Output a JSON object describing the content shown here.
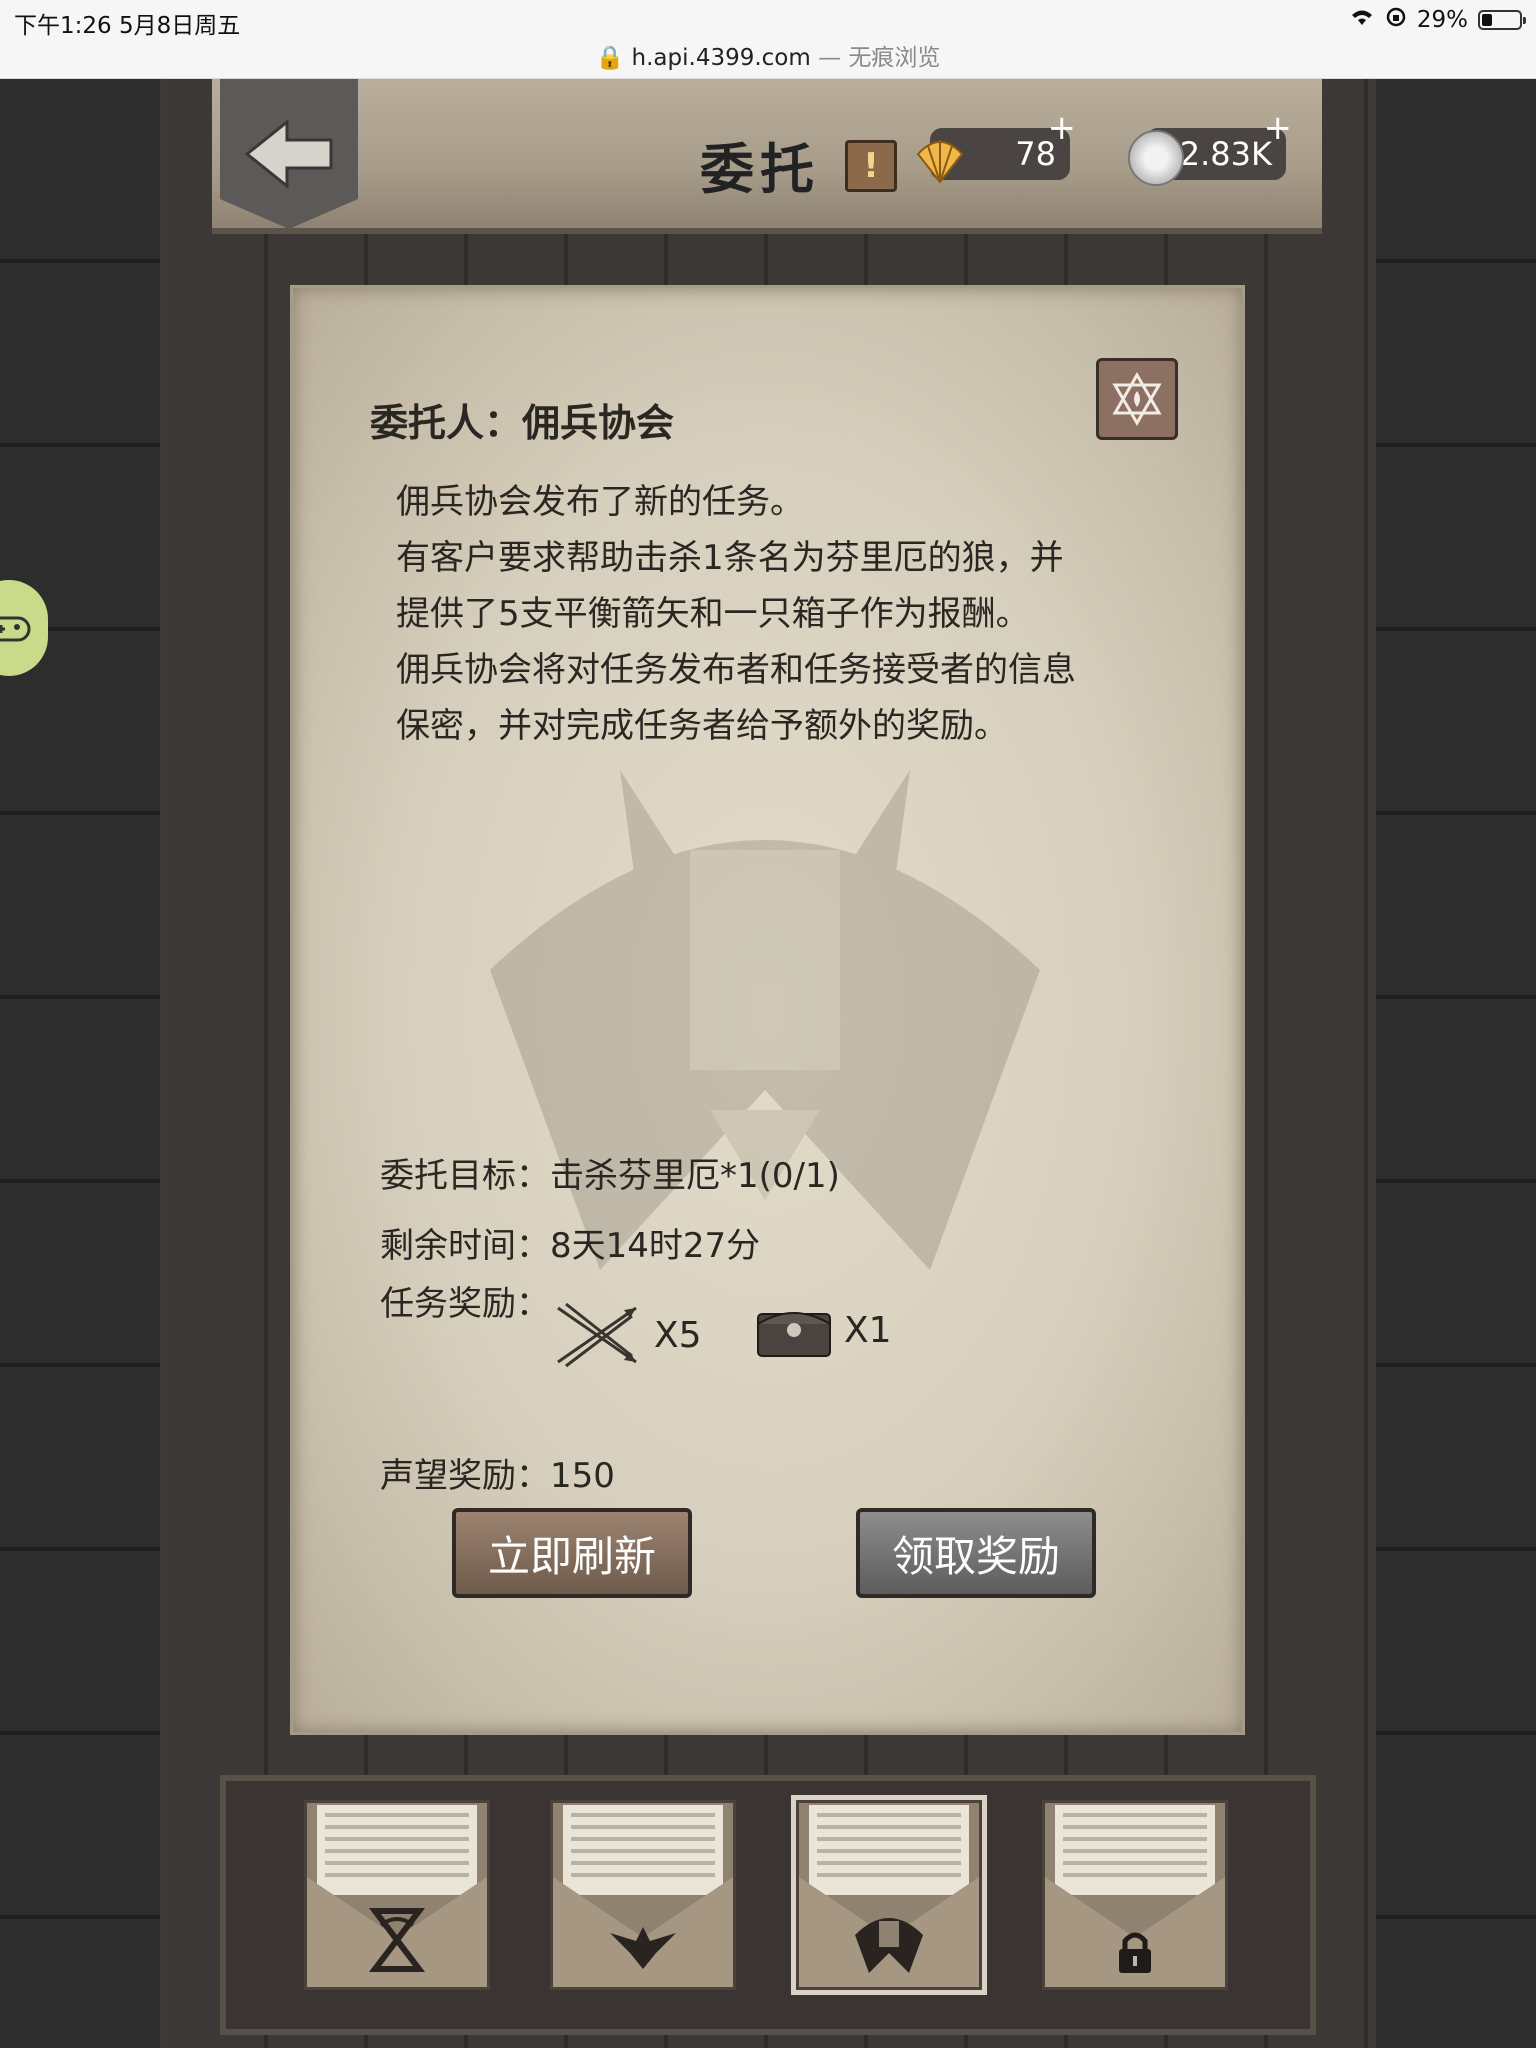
{
  "status_bar": {
    "time": "下午1:26   5月8日周五",
    "battery": "29%",
    "url": "h.api.4399.com",
    "mode": "— 无痕浏览"
  },
  "header": {
    "title": "委托",
    "warning": "!",
    "shells": "78",
    "coins": "2.83K",
    "plus": "+"
  },
  "quest": {
    "client": "委托人：佣兵协会",
    "description": [
      "佣兵协会发布了新的任务。",
      "有客户要求帮助击杀1条名为芬里厄的狼，并",
      "提供了5支平衡箭矢和一只箱子作为报酬。",
      "佣兵协会将对任务发布者和任务接受者的信息",
      "保密，并对完成任务者给予额外的奖励。"
    ],
    "target": "委托目标：击杀芬里厄*1(0/1)",
    "time_left": "剩余时间：8天14时27分",
    "rewards_label": "任务奖励：",
    "rewards": [
      {
        "icon": "arrows-icon",
        "qty": "X5"
      },
      {
        "icon": "chest-icon",
        "qty": "X1"
      }
    ],
    "reputation": "声望奖励：150"
  },
  "buttons": {
    "refresh": "立即刷新",
    "claim": "领取奖励"
  },
  "envelopes": [
    {
      "icon": "hourglass-snake-icon",
      "selected": false
    },
    {
      "icon": "eagle-icon",
      "selected": false
    },
    {
      "icon": "wolf-icon",
      "selected": true
    },
    {
      "icon": "lock-icon",
      "selected": false
    }
  ],
  "colors": {
    "parchment": "#d7cfbd",
    "wood_header": "#a89c8a",
    "button_refresh": "#7c6757",
    "button_claim": "#6e6e6e"
  }
}
